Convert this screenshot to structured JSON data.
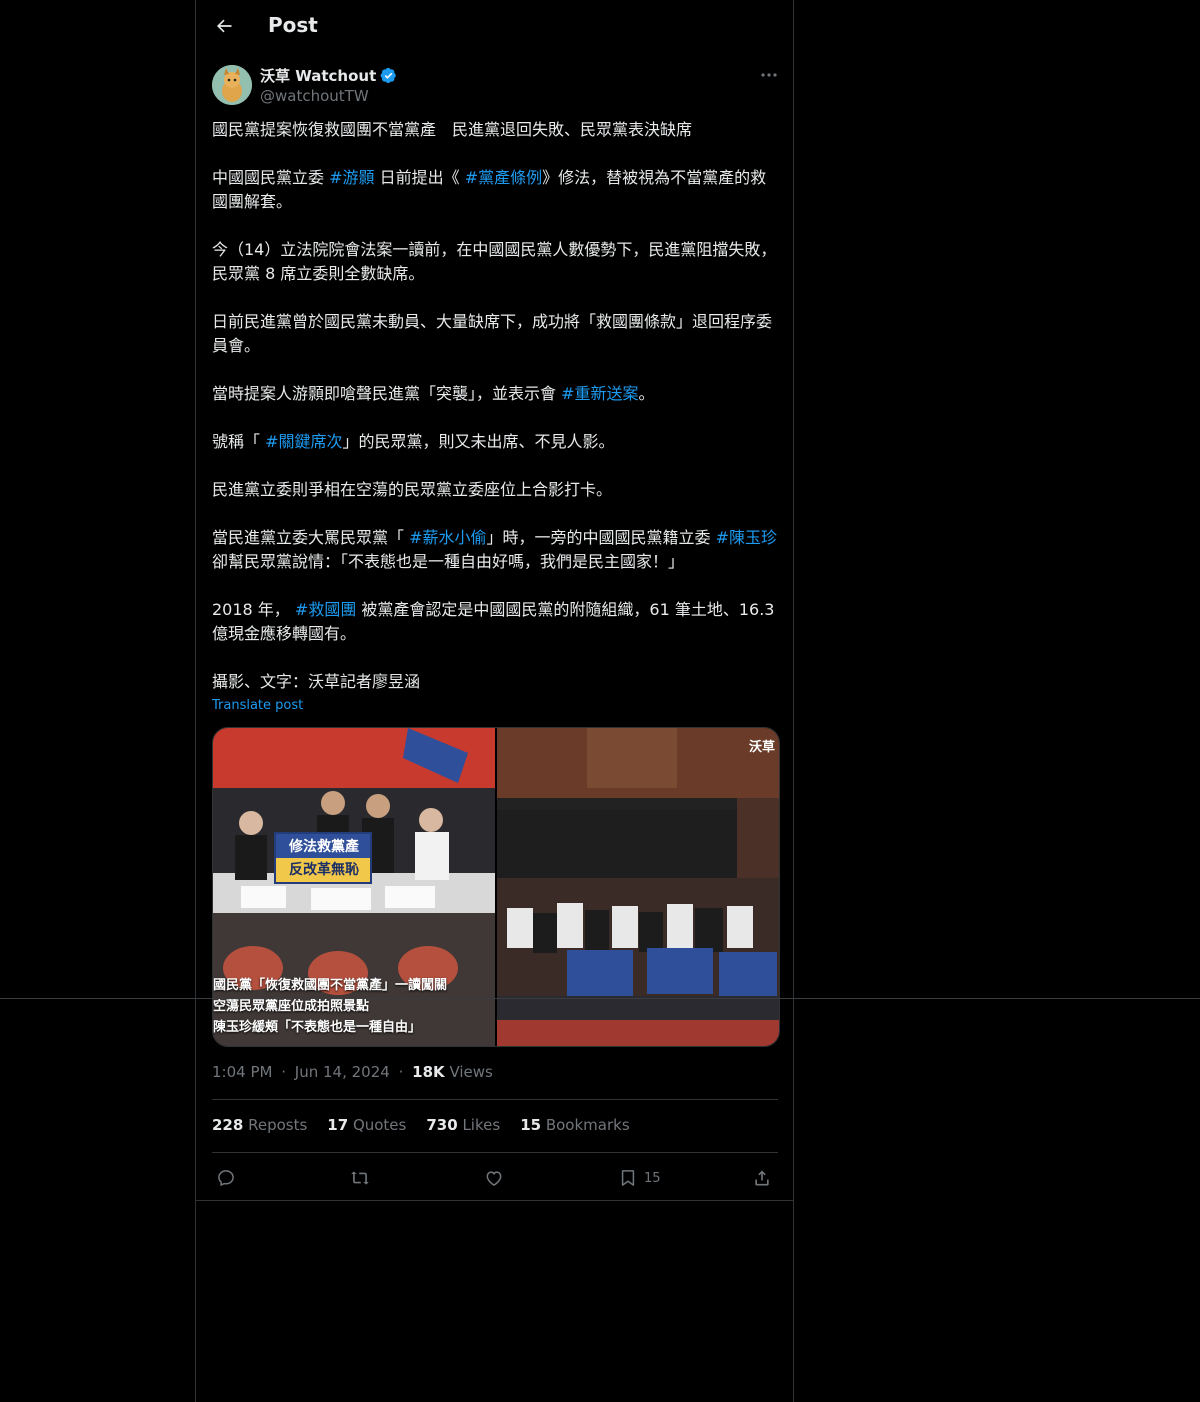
{
  "header": {
    "title": "Post"
  },
  "author": {
    "name": "沃草 Watchout",
    "handle": "@watchoutTW"
  },
  "post": {
    "paragraphs": [
      [
        {
          "t": "國民黨提案恢復救國團不當黨產　民進黨退回失敗、民眾黨表決缺席"
        }
      ],
      [
        {
          "t": "中國國民黨立委 "
        },
        {
          "t": "#游顥",
          "tag": true
        },
        {
          "t": " 日前提出《 "
        },
        {
          "t": "#黨產條例",
          "tag": true
        },
        {
          "t": "》修法，替被視為不當黨產的救國團解套。"
        }
      ],
      [
        {
          "t": "今（14）立法院院會法案一讀前，在中國國民黨人數優勢下，民進黨阻擋失敗，民眾黨 8 席立委則全數缺席。"
        }
      ],
      [
        {
          "t": "日前民進黨曾於國民黨未動員、大量缺席下，成功將「救國團條款」退回程序委員會。"
        }
      ],
      [
        {
          "t": "當時提案人游顥即嗆聲民進黨「突襲」，並表示會 "
        },
        {
          "t": "#重新送案",
          "tag": true
        },
        {
          "t": "。"
        }
      ],
      [
        {
          "t": "號稱「 "
        },
        {
          "t": "#關鍵席次",
          "tag": true
        },
        {
          "t": "」的民眾黨，則又未出席、不見人影。"
        }
      ],
      [
        {
          "t": "民進黨立委則爭相在空蕩的民眾黨立委座位上合影打卡。"
        }
      ],
      [
        {
          "t": "當民進黨立委大罵民眾黨「 "
        },
        {
          "t": "#薪水小偷",
          "tag": true
        },
        {
          "t": "」時，一旁的中國國民黨籍立委 "
        },
        {
          "t": "#陳玉珍",
          "tag": true
        },
        {
          "t": " 卻幫民眾黨說情：「不表態也是一種自由好嗎，我們是民主國家！」"
        }
      ],
      [
        {
          "t": "2018 年， "
        },
        {
          "t": "#救國團",
          "tag": true
        },
        {
          "t": " 被黨產會認定是中國國民黨的附隨組織，61 筆土地、16.3 億現金應移轉國有。"
        }
      ],
      [
        {
          "t": "攝影、文字：沃草記者廖昱涵"
        }
      ]
    ],
    "translate_label": "Translate post"
  },
  "media": {
    "photo1": {
      "sign_top": "修法救黨產",
      "sign_bottom": "反改革無恥",
      "caption_lines": [
        "國民黨「恢復救國團不當黨產」一讀闖關",
        "空蕩民眾黨座位成拍照景點",
        "陳玉珍緩頰「不表態也是一種自由」"
      ]
    },
    "photo2": {
      "watermark": "沃草"
    }
  },
  "meta": {
    "time": "1:04 PM",
    "sep": "·",
    "date": "Jun 14, 2024",
    "views_count": "18K",
    "views_label": "Views"
  },
  "stats": [
    {
      "count": "228",
      "label": "Reposts"
    },
    {
      "count": "17",
      "label": "Quotes"
    },
    {
      "count": "730",
      "label": "Likes"
    },
    {
      "count": "15",
      "label": "Bookmarks"
    }
  ],
  "actions": {
    "bookmark_count": "15"
  },
  "colors": {
    "accent": "#1d9bf0",
    "background": "#000000",
    "text": "#e7e9ea",
    "muted": "#71767b",
    "border": "#2f3336"
  }
}
